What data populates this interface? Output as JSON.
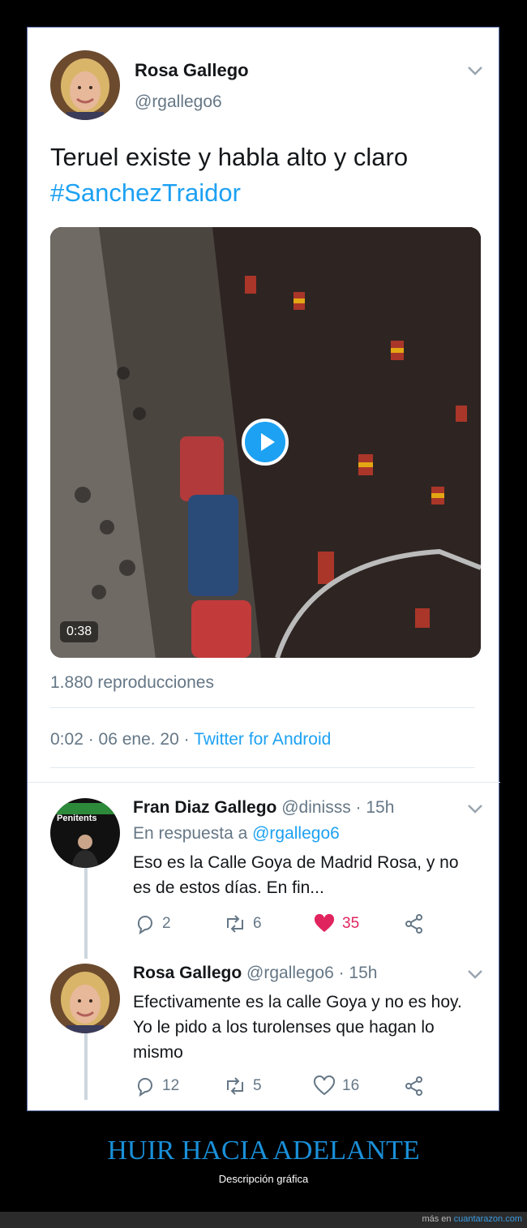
{
  "main_tweet": {
    "author_name": "Rosa Gallego",
    "author_handle": "@rgallego6",
    "text": "Teruel existe y habla alto y claro",
    "hashtag": "#SanchezTraidor",
    "video_duration": "0:38",
    "views": "1.880 reproducciones",
    "time": "0:02 · 06 ene. 20 · ",
    "source": "Twitter for Android"
  },
  "replies": [
    {
      "author_name": "Fran Diaz Gallego",
      "meta": " @dinisss · 15h",
      "reply_to_prefix": "En respuesta a ",
      "reply_to_handle": "@rgallego6",
      "avatar_label": "Penitents",
      "text": "Eso es la Calle Goya de Madrid Rosa, y no es de estos días. En fin...",
      "replies": "2",
      "retweets": "6",
      "likes": "35",
      "liked": true
    },
    {
      "author_name": "Rosa Gallego",
      "meta": " @rgallego6 · 15h",
      "text": "Efectivamente es la calle Goya y no es hoy. Yo le pido a los turolenses que hagan lo mismo",
      "replies": "12",
      "retweets": "5",
      "likes": "16",
      "liked": false
    }
  ],
  "footer": {
    "title": "HUIR HACIA ADELANTE",
    "subtitle": "Descripción gráfica",
    "more_prefix": "más en ",
    "site": "cuantarazon.com"
  },
  "colors": {
    "accent": "#1da1f2",
    "like": "#e0245e",
    "footer_title": "#1a8fd8"
  },
  "icons": [
    "chevron-down-icon",
    "play-icon",
    "reply-icon",
    "retweet-icon",
    "heart-icon",
    "share-icon"
  ]
}
